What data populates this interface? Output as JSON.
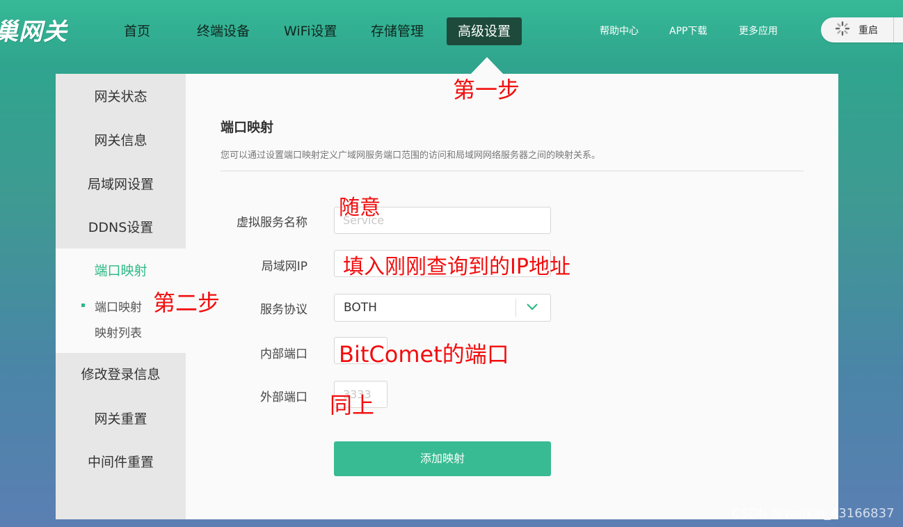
{
  "logo_text": "巢网关",
  "nav": {
    "items": [
      "首页",
      "终端设备",
      "WiFi设置",
      "存储管理",
      "高级设置"
    ],
    "active": "高级设置"
  },
  "top_links": [
    "帮助中心",
    "APP下载",
    "更多应用"
  ],
  "restart": {
    "label": "重启",
    "icon": "spinner-icon"
  },
  "sidebar": {
    "items": [
      "网关状态",
      "网关信息",
      "局域网设置",
      "DDNS设置",
      "端口映射",
      "修改登录信息",
      "网关重置",
      "中间件重置"
    ],
    "active": "端口映射",
    "sub_items": [
      "端口映射",
      "映射列表"
    ]
  },
  "content": {
    "title": "端口映射",
    "description": "您可以通过设置端口映射定义广域网服务端口范围的访问和局域网网络服务器之间的映射关系。"
  },
  "form": {
    "service_name_label": "虚拟服务名称",
    "service_name_placeholder": "Service",
    "lan_ip_label": "局域网IP",
    "protocol_label": "服务协议",
    "protocol_value": "BOTH",
    "internal_port_label": "内部端口",
    "external_port_label": "外部端口",
    "external_port_placeholder": "3333",
    "submit_label": "添加映射"
  },
  "annotations": {
    "step1": "第一步",
    "step2": "第二步",
    "anything": "随意",
    "fill_ip": "填入刚刚查询到的IP地址",
    "bitcomet_port": "BitComet的端口",
    "same_above": "同上"
  },
  "watermark": "CSDN @weixin_43166837",
  "colors": {
    "accent": "#38bb92",
    "active_nav_bg": "#1d4a3b",
    "annotation_red": "#f20d0d"
  }
}
